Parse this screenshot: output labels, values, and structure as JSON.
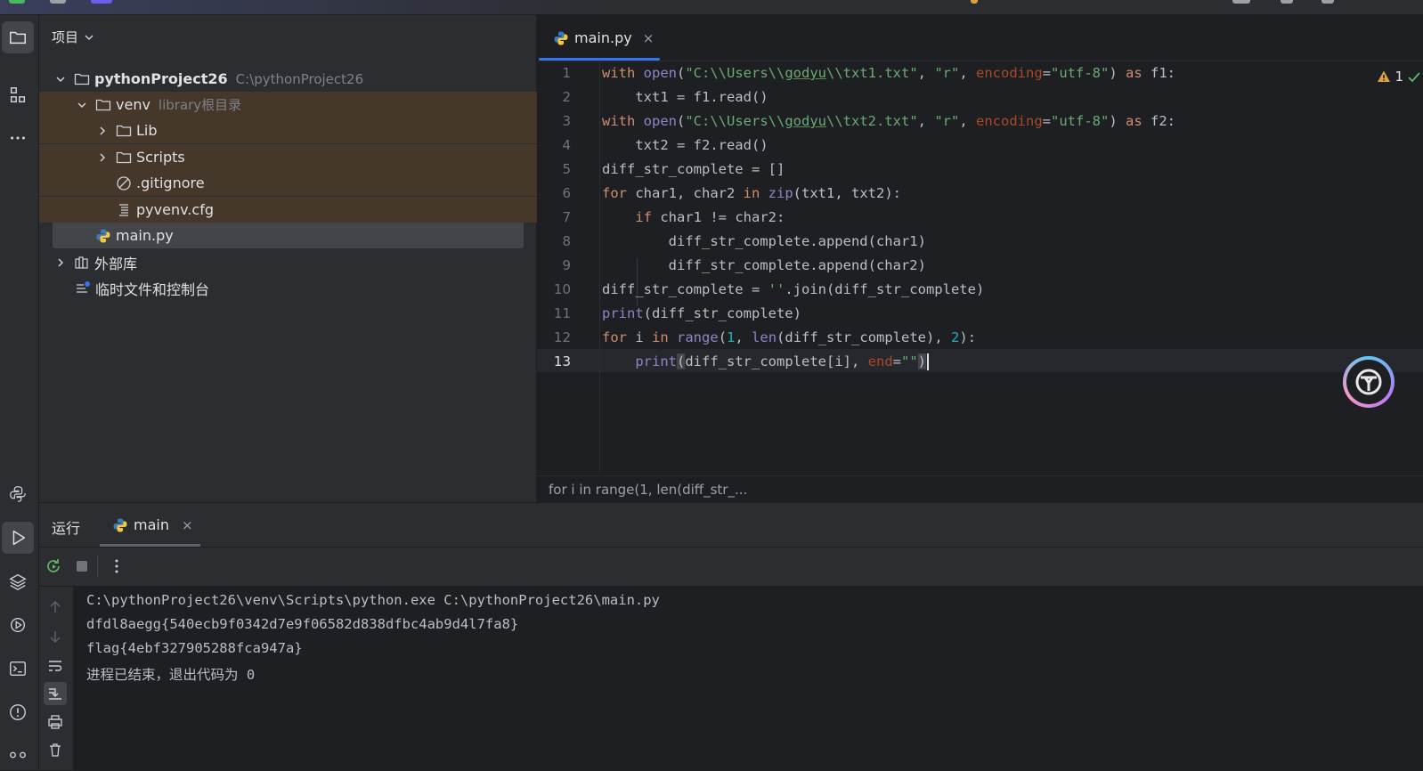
{
  "project_panel": {
    "title": "项目",
    "tree": [
      {
        "name": "pythonProject26",
        "hint": "C:\\pythonProject26",
        "type": "folder",
        "expanded": true
      },
      {
        "name": "venv",
        "hint": "library根目录",
        "type": "folder",
        "expanded": true
      },
      {
        "name": "Lib",
        "type": "folder",
        "expanded": false
      },
      {
        "name": "Scripts",
        "type": "folder",
        "expanded": false
      },
      {
        "name": ".gitignore",
        "type": "ignore-file"
      },
      {
        "name": "pyvenv.cfg",
        "type": "text-file"
      },
      {
        "name": "main.py",
        "type": "python-file",
        "selected": true
      },
      {
        "name": "外部库",
        "type": "library",
        "expanded": false
      },
      {
        "name": "临时文件和控制台",
        "type": "scratches"
      }
    ]
  },
  "editor": {
    "tab": {
      "label": "main.py",
      "close": "×"
    },
    "inspections": {
      "warnings": "1"
    },
    "line_numbers": [
      "1",
      "2",
      "3",
      "4",
      "5",
      "6",
      "7",
      "8",
      "9",
      "10",
      "11",
      "12",
      "13"
    ],
    "current_line": "13",
    "breadcrumb": "for i in range(1, len(diff_str_...",
    "code": {
      "l1": {
        "kw1": "with",
        "fn": "open",
        "p1": "(",
        "s1a": "\"C:\\\\Users\\\\",
        "s1u": "godyu",
        "s1b": "\\\\txt1.txt\"",
        "c1": ", ",
        "s2": "\"r\"",
        "c2": ", ",
        "prm": "encoding",
        "eq": "=",
        "s3": "\"utf-8\"",
        "p2": ") ",
        "kw2": "as",
        "tail": " f1:"
      },
      "l2": "    txt1 = f1.read()",
      "l3": {
        "kw1": "with",
        "fn": "open",
        "p1": "(",
        "s1a": "\"C:\\\\Users\\\\",
        "s1u": "godyu",
        "s1b": "\\\\txt2.txt\"",
        "c1": ", ",
        "s2": "\"r\"",
        "c2": ", ",
        "prm": "encoding",
        "eq": "=",
        "s3": "\"utf-8\"",
        "p2": ") ",
        "kw2": "as",
        "tail": " f2:"
      },
      "l4": "    txt2 = f2.read()",
      "l5": "diff_str_complete = []",
      "l6": {
        "kw1": "for",
        "a": " char1, char2 ",
        "kw2": "in",
        "sp": " ",
        "fn": "zip",
        "tail": "(txt1, txt2):"
      },
      "l7": {
        "ind": "    ",
        "kw": "if",
        "tail": " char1 != char2:"
      },
      "l8": "        diff_str_complete.append(char1)",
      "l9": "        diff_str_complete.append(char2)",
      "l10": {
        "a": "diff_str_complete = ",
        "s": "''",
        "tail": ".join(diff_str_complete)"
      },
      "l11": {
        "fn": "print",
        "tail": "(diff_str_complete)"
      },
      "l12": {
        "kw1": "for",
        "a": " i ",
        "kw2": "in",
        "sp": " ",
        "fn1": "range",
        "p": "(",
        "n1": "1",
        "c": ", ",
        "fn2": "len",
        "mid": "(diff_str_complete), ",
        "n2": "2",
        "tail": "):"
      },
      "l13": {
        "ind": "    ",
        "fn": "print",
        "p1": "(",
        "a": "diff_str_complete[i], ",
        "prm": "end",
        "eq": "=",
        "s": "\"\"",
        "p2": ")"
      }
    }
  },
  "run_panel": {
    "title": "运行",
    "tab": {
      "label": "main",
      "close": "×"
    },
    "console": [
      "C:\\pythonProject26\\venv\\Scripts\\python.exe C:\\pythonProject26\\main.py",
      "dfdl8aegg{540ecb9f0342d7e9f06582d838dfbc4ab9d4l7fa8}",
      "flag{4ebf327905288fca947a}",
      "进程已结束，退出代码为 0"
    ]
  },
  "colors": {
    "accent": "#3574f0",
    "keyword": "#cf8e6d",
    "string": "#6aab73",
    "builtin": "#8888c6",
    "number": "#2aacb8",
    "excluded_bg": "#45372a"
  }
}
